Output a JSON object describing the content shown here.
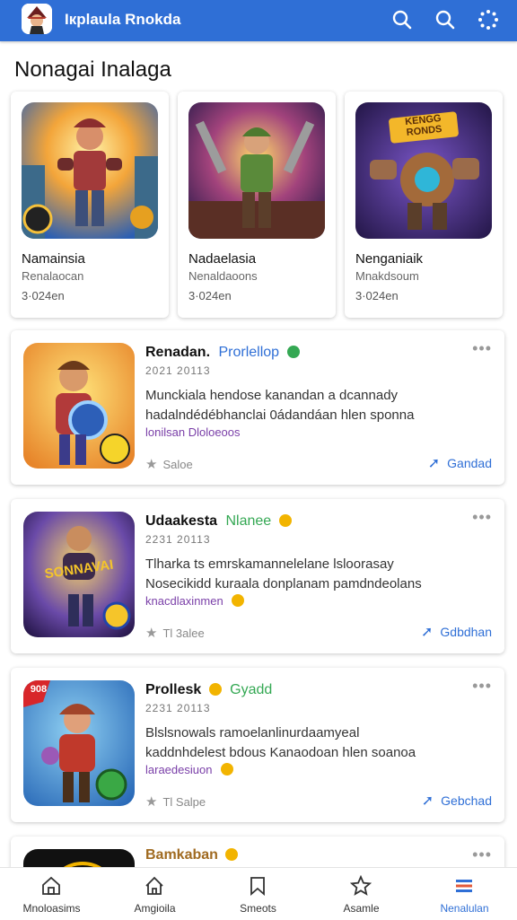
{
  "app": {
    "title": "Iкplaula Rnokda"
  },
  "section": {
    "title": "Nonagai Inalaga"
  },
  "cards": [
    {
      "name": "Namainsia",
      "sub": "Renalaocan",
      "size": "3·024en"
    },
    {
      "name": "Nadaelasia",
      "sub": "Nenaldaoons",
      "size": "3·024en"
    },
    {
      "name": "Nenganiaik",
      "sub": "Mnakdsoum",
      "size": "3·024en",
      "logo_text": "KENGG\nRONDS"
    }
  ],
  "list": [
    {
      "title": "Renadan.",
      "tag": "Prorlellop",
      "tag_color": "#2f6fd6",
      "badge_color": "#34a853",
      "date": "2021 20113",
      "desc1": "Munckiala hendose  kanandan a dcannady",
      "desc2": "hadalndédébhanclai  0ádandáan hlen sponna",
      "category": "lonilsan Dloloeoos",
      "rating": "Saloe",
      "action": "Gandad"
    },
    {
      "title": "Udaakesta",
      "tag": "Nlanee",
      "tag_color": "#34a853",
      "badge_color": "#f2b400",
      "date": "2231 20113",
      "desc1": "Tlharka ts  emrskamannelelane lsloorasay",
      "desc2": "Nosecikidd kuraala donplanam pamdndeolans",
      "category": "knacdlaxinmen",
      "rating": "Tl 3alee",
      "action": "Gdbdhan",
      "icon_text": "SONNAVAI"
    },
    {
      "title": "Prollesk",
      "tag": "Gyadd",
      "tag_color": "#34a853",
      "badge_color": "#f2b400",
      "date": "2231 20113",
      "desc1": "Blslsnowals ramoelanlinurdaamyeal",
      "desc2": "kaddnhdelest  bdous  Kanaodoan hlen soanoa",
      "category": "laraedesiuon",
      "rating": "Tl Salpe",
      "action": "Gebchad",
      "icon_text": "908"
    },
    {
      "title": "Bamkaban",
      "tag": "",
      "tag_color": "#34a853",
      "badge_color": "#f2b400"
    }
  ],
  "nav": [
    {
      "label": "Mnoloasims"
    },
    {
      "label": "Amgioila"
    },
    {
      "label": "Smeots"
    },
    {
      "label": "Asamle"
    },
    {
      "label": "Nenalulan"
    }
  ],
  "colors": {
    "primary": "#2f6fd6",
    "purple": "#7a3fa8",
    "green": "#34a853",
    "gold": "#f2b400"
  }
}
